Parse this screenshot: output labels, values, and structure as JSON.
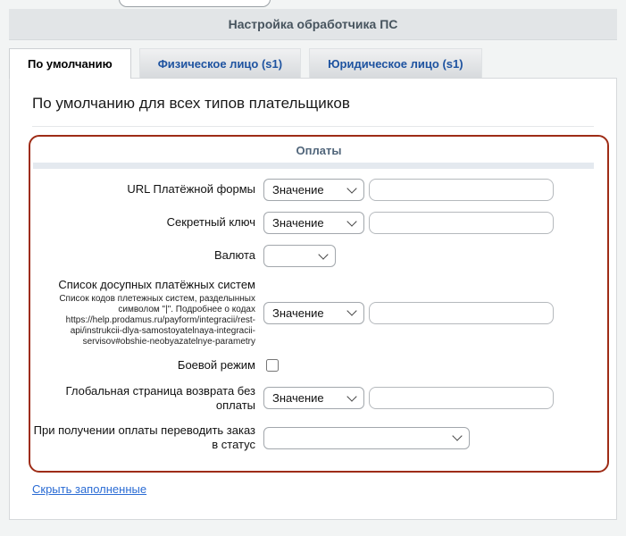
{
  "header": {
    "title": "Настройка обработчика ПС"
  },
  "tabs": {
    "items": [
      {
        "label": "По умолчанию",
        "active": true
      },
      {
        "label": "Физическое лицо (s1)",
        "active": false
      },
      {
        "label": "Юридическое лицо (s1)",
        "active": false
      }
    ]
  },
  "panel": {
    "heading": "По умолчанию для всех типов плательщиков",
    "section": {
      "title": "Оплаты",
      "rows": [
        {
          "label": "URL Платёжной формы",
          "type": "select+input",
          "select_value": "Значение",
          "input_value": ""
        },
        {
          "label": "Секретный ключ",
          "type": "select+input",
          "select_value": "Значение",
          "input_value": ""
        },
        {
          "label": "Валюта",
          "type": "select",
          "select_value": ""
        },
        {
          "label": "Список досупных платёжных систем",
          "description": "Список кодов плетежных систем, разделынных символом \"|\". Подробнее о кодах https://help.prodamus.ru/payform/integracii/rest-api/instrukcii-dlya-samostoyatelnaya-integracii-servisov#obshie-neobyazatelnye-parametry",
          "type": "select+input",
          "select_value": "Значение",
          "input_value": ""
        },
        {
          "label": "Боевой режим",
          "type": "checkbox",
          "checked": false
        },
        {
          "label": "Глобальная страница возврата без оплаты",
          "type": "select+input",
          "select_value": "Значение",
          "input_value": ""
        },
        {
          "label": "При получении оплаты переводить заказ в статус",
          "type": "select-wide",
          "select_value": ""
        }
      ]
    },
    "footer_link": "Скрыть заполненные"
  },
  "colors": {
    "accent_border": "#9e2c16",
    "tab_link_blue": "#1e53a0",
    "link_blue": "#2b6cd4",
    "header_bg": "#e2e5e7",
    "section_bar": "#e4e9ef"
  }
}
